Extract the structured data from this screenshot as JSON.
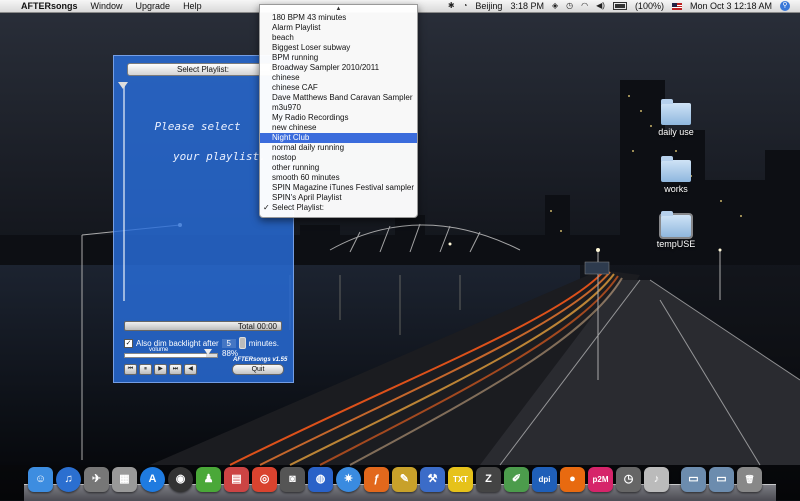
{
  "menubar": {
    "apple_glyph": "",
    "app_name": "AFTERsongs",
    "menus": [
      "Window",
      "Upgrade",
      "Help"
    ],
    "city": "Beijing",
    "city_time": "3:18 PM",
    "battery": "(100%)",
    "date_time": "Mon Oct 3  12:18 AM"
  },
  "player": {
    "select_label": "Select Playlist:",
    "prompt_line1": "Please select",
    "prompt_line2": "your playlist.",
    "total": "Total 00:00",
    "dim_label": "Also dim backlight after",
    "dim_value": "5",
    "dim_unit": "minutes.",
    "dim_checked": true,
    "volume_label": "volume",
    "volume_percent": "88%",
    "volume_level": 0.88,
    "brand": "AFTERsongs v1.55",
    "controls": [
      "⏮",
      "⏸",
      "▶",
      "⏭",
      "◀"
    ],
    "quit": "Quit"
  },
  "dropdown": {
    "scroll_up_glyph": "▲",
    "items": [
      "180 BPM 43 minutes",
      "Alarm Playlist",
      "beach",
      "Biggest Loser subway",
      "BPM running",
      "Broadway Sampler 2010/2011",
      "chinese",
      "chinese CAF",
      "Dave Matthews Band Caravan Sampler",
      "m3u970",
      "My Radio Recordings",
      "new chinese",
      "Night Club",
      "normal daily running",
      "nostop",
      "other running",
      "smooth 60 minutes",
      "SPIN Magazine iTunes Festival sampler",
      "SPIN's April Playlist",
      "Select Playlist:"
    ],
    "highlighted": "Night Club",
    "checked": "Select Playlist:",
    "check_glyph": "✓"
  },
  "desktop": {
    "folders": [
      "daily use",
      "works",
      "tempUSE"
    ]
  },
  "dock": {
    "apps": [
      {
        "name": "finder-icon",
        "glyph": "☺",
        "color": "#3d8de0"
      },
      {
        "name": "itunes-icon",
        "glyph": "♫",
        "color": "#2b6fd0"
      },
      {
        "name": "launchpad-icon",
        "glyph": "✈",
        "color": "#777"
      },
      {
        "name": "calendar-icon",
        "glyph": "▦",
        "color": "#999"
      },
      {
        "name": "app-store-icon",
        "glyph": "A",
        "color": "#1f7be0"
      },
      {
        "name": "dashboard-icon",
        "glyph": "◉",
        "color": "#333"
      },
      {
        "name": "messenger-icon",
        "glyph": "♟",
        "color": "#4aa838"
      },
      {
        "name": "ical-icon",
        "glyph": "▤",
        "color": "#c44"
      },
      {
        "name": "chrome-icon",
        "glyph": "◎",
        "color": "#d9432f"
      },
      {
        "name": "camera-icon",
        "glyph": "◙",
        "color": "#555"
      },
      {
        "name": "globe-icon",
        "glyph": "◍",
        "color": "#2a62c8"
      },
      {
        "name": "safari-icon",
        "glyph": "✷",
        "color": "#3a8be0"
      },
      {
        "name": "firefox-icon",
        "glyph": "ƒ",
        "color": "#e2681c"
      },
      {
        "name": "pencil-icon",
        "glyph": "✎",
        "color": "#c8a12a"
      },
      {
        "name": "xcode-icon",
        "glyph": "⚒",
        "color": "#3b6cc8"
      },
      {
        "name": "txt-icon",
        "glyph": "TXT",
        "color": "#e6c21a"
      },
      {
        "name": "zip-icon",
        "glyph": "Z",
        "color": "#444"
      },
      {
        "name": "dictionary-icon",
        "glyph": "✐",
        "color": "#4c9c4c"
      },
      {
        "name": "dpi-icon",
        "glyph": "dpi",
        "color": "#1f5fb8"
      },
      {
        "name": "burn-icon",
        "glyph": "●",
        "color": "#e86a10"
      },
      {
        "name": "p2m-icon",
        "glyph": "p2M",
        "color": "#d6246a"
      },
      {
        "name": "clock-icon",
        "glyph": "◷",
        "color": "#666"
      },
      {
        "name": "music-icon",
        "glyph": "♪",
        "color": "#bbb"
      }
    ],
    "stacks": [
      {
        "name": "applications-stack-icon",
        "glyph": "▭",
        "color": "#6c8cae"
      },
      {
        "name": "downloads-stack-icon",
        "glyph": "▭",
        "color": "#6c8cae"
      },
      {
        "name": "trash-icon",
        "glyph": "🗑",
        "color": "#888"
      }
    ]
  }
}
